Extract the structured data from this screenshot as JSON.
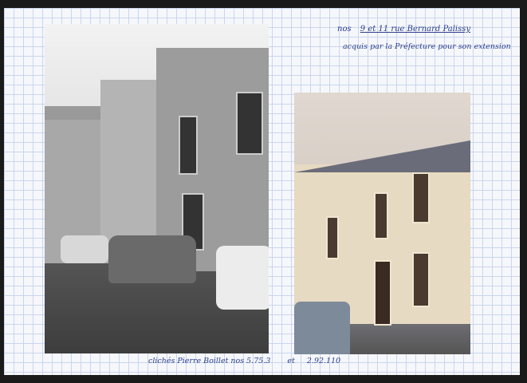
{
  "annotation": {
    "line1_prefix": "nos",
    "line1_address": "9 et 11 rue Bernard Palissy",
    "line2": "acquis par la Préfecture pour son extension"
  },
  "caption": {
    "credit": "clichés Pierre Boillet nos 5.75.3",
    "connector": "et",
    "ref2": "2.92.110"
  },
  "photos": [
    {
      "tone": "black-and-white",
      "subject": "street-facade-old"
    },
    {
      "tone": "color",
      "subject": "street-facade-restored"
    }
  ]
}
